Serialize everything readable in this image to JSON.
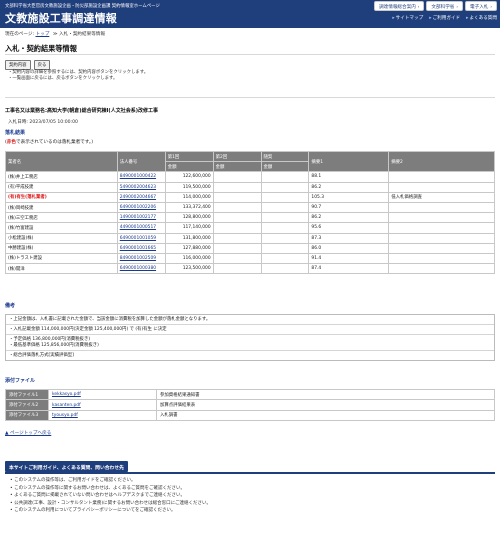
{
  "header": {
    "subtitle": "文部科学省大臣官房文教施設企画・防災部施設企画課 契約情報室ホームページ",
    "title": "文教施設工事調達情報",
    "buttons": [
      "調達情報総合案内",
      "文部科学省",
      "電子入札"
    ],
    "nav": [
      "サイトマップ",
      "ご利用ガイド",
      "よくある質問"
    ]
  },
  "breadcrumb": {
    "prefix": "現在のページ:",
    "top": "トップ",
    "sep": "≫",
    "current": "入札・契約結果等情報"
  },
  "page_title": "入札・契約結果等情報",
  "action_buttons": [
    "契約内容",
    "戻る"
  ],
  "notes": [
    "契約内容の詳細を参照するには、契約内容ボタンをクリックします。",
    "一覧画面に戻るには、戻るボタンをクリックします。"
  ],
  "contract": {
    "name": "工事名又は業務名:高知大学(朝倉)総合研究棟I(人文社会系)改修工事",
    "date_label": "入札日時:",
    "date": "2023/07/05 10:00:00"
  },
  "result_section": {
    "title": "落札結果",
    "legend_pre": "(",
    "legend_red": "赤色",
    "legend_post": "で表示されているのは落札業者です。)"
  },
  "table": {
    "headers_top": [
      "業者名",
      "法人番号",
      "第1回",
      "第2回",
      "随契",
      "摘要1",
      "摘要2"
    ],
    "headers_sub": [
      "金額",
      "金額",
      "金額"
    ],
    "rows": [
      {
        "name": "(株)井上工務店",
        "corp": "8490001000422",
        "amount": "122,600,000",
        "r1": "88.1",
        "r2": "",
        "winner": false
      },
      {
        "name": "(有)平成技建",
        "corp": "5490002004623",
        "amount": "119,500,000",
        "r1": "86.2",
        "r2": "",
        "winner": false
      },
      {
        "name": "(有)有生(落札業者)",
        "corp": "2490002004667",
        "amount": "114,000,000",
        "r1": "105.3",
        "r2": "低入札価格調査",
        "winner": true
      },
      {
        "name": "(株)岡崎技建",
        "corp": "6490001002206",
        "amount": "133,372,400",
        "r1": "90.7",
        "r2": "",
        "winner": false
      },
      {
        "name": "(株)三空工務店",
        "corp": "1490001002177",
        "amount": "128,800,000",
        "r1": "86.2",
        "r2": "",
        "winner": false
      },
      {
        "name": "(株)竹富建設",
        "corp": "4490001000517",
        "amount": "117,140,000",
        "r1": "95.6",
        "r2": "",
        "winner": false
      },
      {
        "name": "小松建設(株)",
        "corp": "6490001001059",
        "amount": "131,800,000",
        "r1": "87.3",
        "r2": "",
        "winner": false
      },
      {
        "name": "中勝建設(株)",
        "corp": "6490001001665",
        "amount": "127,880,000",
        "r1": "86.0",
        "r2": "",
        "winner": false
      },
      {
        "name": "(株)トラスト建設",
        "corp": "8490001002509",
        "amount": "116,000,000",
        "r1": "91.4",
        "r2": "",
        "winner": false
      },
      {
        "name": "(株)開洋",
        "corp": "6490001000380",
        "amount": "123,500,000",
        "r1": "87.4",
        "r2": "",
        "winner": false
      }
    ]
  },
  "remarks": {
    "title": "備考",
    "lines": [
      [
        "・上記金額は、入札書に記載された金額で、当該金額に消費税を加算した金額が落札金額となります。"
      ],
      [
        "・入札記載金額 114,000,000円(決定金額 125,400,000円) で (有)有生 に決定"
      ],
      [
        "・予定価格 136,800,000円(消費税抜き)",
        "・最低基準価格 125,856,000円(消費税抜き)"
      ],
      [
        "・総合評価落札方式[実績評価型]"
      ]
    ]
  },
  "attachments": {
    "title": "添付ファイル",
    "rows": [
      {
        "label": "添付ファイル1",
        "file": "kekkasyo.pdf",
        "desc": "参加資格結果通知書"
      },
      {
        "label": "添付ファイル2",
        "file": "kasanten.pdf",
        "desc": "加算点評価結果表"
      },
      {
        "label": "添付ファイル3",
        "file": "tyousyo.pdf",
        "desc": "入札調書"
      }
    ]
  },
  "to_top": "ページトップへ戻る",
  "footer": {
    "box_title": "本サイトご利用ガイド、よくある質問、問い合わせ先",
    "items": [
      "このシステムの操作等は、ご利用ガイドをご確認ください。",
      "このシステムの操作等に関するお問い合わせは、よくあるご質問をご確認ください。",
      "よくあるご質問に掲載されていない問い合わせはヘルプデスクまでご連絡ください。",
      "公共調達(工事、設計・コンサルタント業務)に関するお問い合わせは総合窓口にご連絡ください。",
      "このシステムの利用についてプライバシーポリシーについてをご確認ください。"
    ]
  }
}
